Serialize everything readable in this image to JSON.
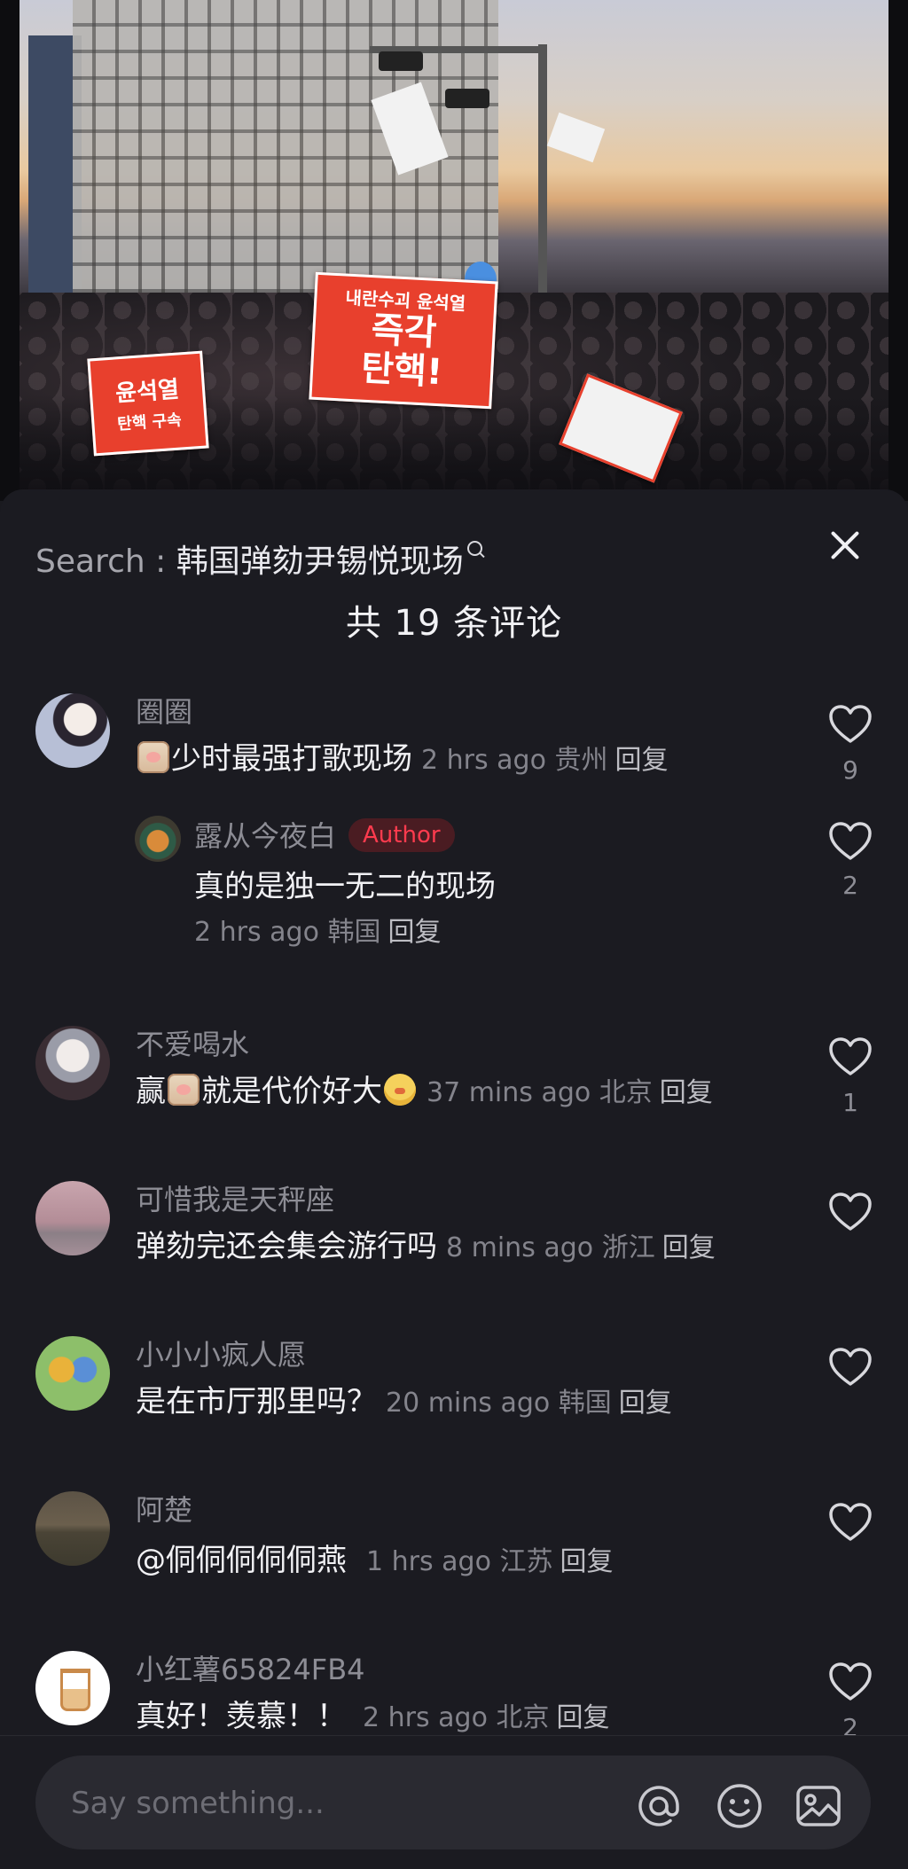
{
  "sheet": {
    "search_label": "Search : ",
    "search_query": "韩国弹劾尹锡悦现场",
    "comment_count": "共 19 条评论"
  },
  "video": {
    "sign_main_line1": "내란수괴 윤석열",
    "sign_main_line2": "즉각",
    "sign_main_line3": "탄핵!",
    "sign_left_line1": "윤석열",
    "sign_left_line2": "탄핵 구속"
  },
  "comments": [
    {
      "name": "圈圈",
      "text": "少时最强打歌现场",
      "time": "2 hrs ago",
      "location": "贵州",
      "reply": "回复",
      "likes": "9",
      "replies": [
        {
          "name": "露从今夜白",
          "badge": "Author",
          "text": "真的是独一无二的现场",
          "time": "2 hrs ago",
          "location": "韩国",
          "reply": "回复",
          "likes": "2"
        }
      ]
    },
    {
      "name": "不爱喝水",
      "text_pre": "赢",
      "text_post": "就是代价好大",
      "time": "37 mins ago",
      "location": "北京",
      "reply": "回复",
      "likes": "1"
    },
    {
      "name": "可惜我是天秤座",
      "text": "弹劾完还会集会游行吗",
      "time": "8 mins ago",
      "location": "浙江",
      "reply": "回复",
      "likes": ""
    },
    {
      "name": "小小小疯人愿",
      "text": "是在市厅那里吗？",
      "time": "20 mins ago",
      "location": "韩国",
      "reply": "回复",
      "likes": ""
    },
    {
      "name": "阿楚",
      "text": "@侗侗侗侗侗燕",
      "time": "1 hrs ago",
      "location": "江苏",
      "reply": "回复",
      "likes": ""
    },
    {
      "name": "小红薯65824FB4",
      "text": "真好！羡慕！！",
      "time": "2 hrs ago",
      "location": "北京",
      "reply": "回复",
      "likes": "2"
    }
  ],
  "input": {
    "placeholder": "Say something..."
  },
  "icons": {
    "close": "close-icon",
    "like": "heart-outline-icon",
    "mention": "at-icon",
    "emoji": "smiley-icon",
    "image": "image-icon",
    "search": "search-icon"
  },
  "colors": {
    "background": "#1b1b21",
    "author_badge_text": "#ff3b4e",
    "author_badge_bg": "#4a1c22"
  }
}
